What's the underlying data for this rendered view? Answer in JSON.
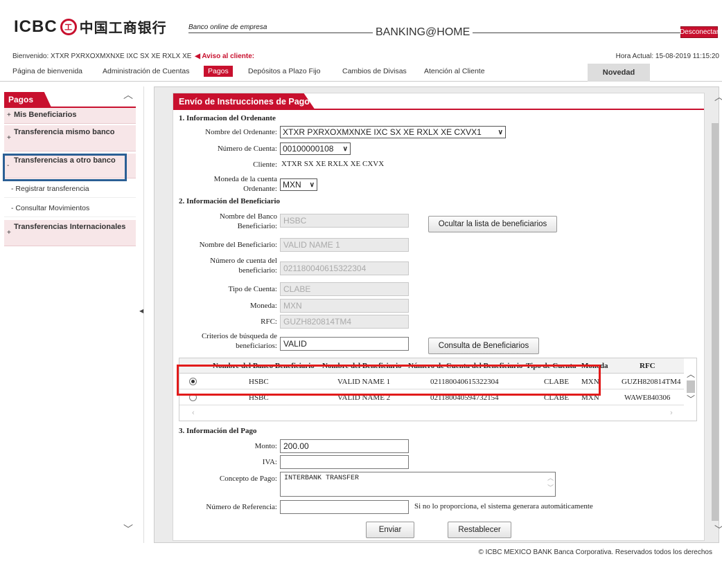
{
  "header": {
    "logo_text": "ICBC",
    "logo_seal": "工",
    "logo_cn": "中国工商银行",
    "online_label": "Banco online de empresa",
    "banking_title": "BANKING@HOME",
    "logout_label": "Desconectar",
    "welcome": "Bienvenido: XTXR PXRXOXMXNXE IXC SX XE RXLX XE",
    "warning": "Aviso al cliente:",
    "time": "Hora Actual: 15-08-2019 11:15:20"
  },
  "nav": {
    "items": [
      "Página de bienvenida",
      "Administración de Cuentas",
      "Pagos",
      "Depósitos a Plazo Fijo",
      "Cambios de Divisas",
      "Atención al Cliente"
    ],
    "active": "Pagos",
    "novedad": "Novedad"
  },
  "sidebar": {
    "title": "Pagos",
    "items": [
      {
        "pm": "+",
        "label": "Mis Beneficiarios"
      },
      {
        "pm": "+",
        "label": "Transferencia mismo banco"
      },
      {
        "pm": "-",
        "label": "Transferencias a otro banco"
      },
      {
        "pm": "+",
        "label": "Transferencias Internacionales"
      }
    ],
    "subitems": [
      "- Registrar transferencia",
      "- Consultar Movimientos"
    ]
  },
  "form": {
    "title": "Envío de Instrucciones de Pago",
    "section1": "1. Informacion del Ordenante",
    "ordenante_label": "Nombre del Ordenante:",
    "ordenante_value": "XTXR PXRXOXMXNXE IXC SX XE RXLX XE CXVX1",
    "cuenta_label": "Número de Cuenta:",
    "cuenta_value": "00100000108",
    "cliente_label": "Cliente:",
    "cliente_value": "XTXR SX XE RXLX XE CXVX",
    "moneda_label_1": "Moneda de la cuenta",
    "moneda_label_2": "Ordenante:",
    "moneda_value": "MXN",
    "section2": "2. Información del Beneficiario",
    "banco_label_1": "Nombre del Banco",
    "banco_label_2": "Beneficiario:",
    "banco_value": "HSBC",
    "ocultar_button": "Ocultar la lista de beneficiarios",
    "nombre_label": "Nombre del Beneficiario:",
    "nombre_value": "VALID NAME 1",
    "num_label_1": "Número de cuenta del",
    "num_label_2": "beneficiario:",
    "num_value": "021180040615322304",
    "tipo_label": "Tipo de Cuenta:",
    "tipo_value": "CLABE",
    "moneda_b_label": "Moneda:",
    "moneda_b_value": "MXN",
    "rfc_label": "RFC:",
    "rfc_value": "GUZH820814TM4",
    "criterios_label_1": "Criterios de búsqueda de",
    "criterios_label_2": "beneficiarios:",
    "criterios_value": "VALID",
    "consulta_button": "Consulta de Beneficiarios",
    "section3": "3. Información del Pago",
    "monto_label": "Monto:",
    "monto_value": "200.00",
    "iva_label": "IVA:",
    "iva_value": "",
    "concepto_label": "Concepto de Pago:",
    "concepto_value": "INTERBANK TRANSFER",
    "referencia_label": "Número de Referencia:",
    "referencia_value": "",
    "referencia_hint": "Si no lo proporciona, el sistema generara automáticamente",
    "enviar_button": "Enviar",
    "restablecer_button": "Restablecer"
  },
  "table": {
    "headers": [
      "Nombre del Banco Beneficiario",
      "Nombre del Beneficiario",
      "Número de Cuenta del Beneficiario",
      "Tipo de Cuenta",
      "Moneda",
      "RFC"
    ],
    "rows": [
      {
        "selected": true,
        "banco": "HSBC",
        "nombre": "VALID NAME 1",
        "cuenta": "021180040615322304",
        "tipo": "CLABE",
        "moneda": "MXN",
        "rfc": "GUZH820814TM4"
      },
      {
        "selected": false,
        "banco": "HSBC",
        "nombre": "VALID NAME 2",
        "cuenta": "021180040594732154",
        "tipo": "CLABE",
        "moneda": "MXN",
        "rfc": "WAWE840306"
      }
    ]
  },
  "footer": "© ICBC MEXICO BANK Banca Corporativa. Reservados todos los derechos"
}
